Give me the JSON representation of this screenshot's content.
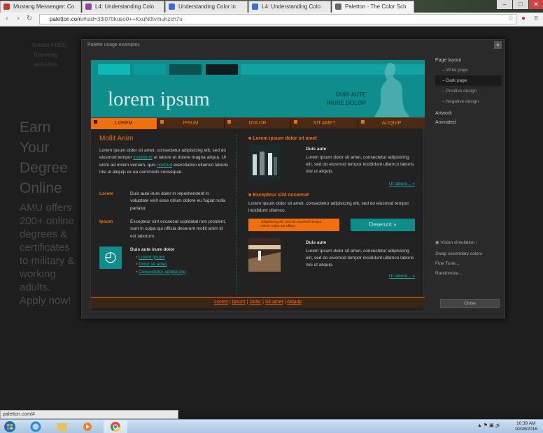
{
  "browser": {
    "tabs": [
      {
        "label": "Mustang Messenger: Co",
        "color": "#c0392b"
      },
      {
        "label": "L4: Understanding Colo",
        "color": "#8e44ad"
      },
      {
        "label": "Understanding Color in",
        "color": "#3a6fd8"
      },
      {
        "label": "L4: Understanding Colo",
        "color": "#3a6fd8"
      },
      {
        "label": "Paletton - The Color Sch",
        "color": "#666666"
      }
    ],
    "url_host": "paletton.com",
    "url_path": "/#uid=33i070kuso0++KxuN0tvmuhzch7u",
    "window_buttons": [
      "–",
      "□",
      "✕"
    ]
  },
  "background": {
    "ghost_links": [
      "Create FREE",
      "Stunning",
      "websites"
    ],
    "ad_big": "Earn Your Degree Online",
    "ad_small": "AMU offers 200+ online degrees & certificates to military & working adults. Apply now!"
  },
  "modal": {
    "title": "Palette usage examples",
    "close": "×",
    "header": {
      "title": "lorem ipsum",
      "tagline_1": "DUIS AUTE",
      "tagline_2": "IRURE DOLOR",
      "swatches": [
        "#0fb8b8",
        "#0a9a9a",
        "#0d5050",
        "#111d1d"
      ]
    },
    "menu": [
      "LOREM",
      "IPSUM",
      "DOLOR",
      "SIT AMET",
      "ALIQUIP"
    ],
    "left": {
      "heading": "Mollit Anim",
      "para1_a": "Lorem ipsum dolor sit amet, consectetur adipisicing elit, sed do eiusmod tempor ",
      "para1_link1": "incididunt",
      "para1_b": " ut labore et dolore magna aliqua. Ut enim ad minim veniam, quis ",
      "para1_link2": "nostrud",
      "para1_c": " exercitation ullamco laboris nisi ut aliquip ex ea commodo consequat.",
      "item1_label": "Lorem",
      "item1_text": "Duis aute irure dolor in reprehenderit in voluptate velit esse cillum dolore eu fugiat nulla pariatur.",
      "item2_label": "Ipsum",
      "item2_text": "Excepteur sint occaecat cupidatat non proident, sunt in culpa qui officia deserunt mollit anim id est laborum.",
      "list_heading": "Duis aute irure dolor",
      "list": [
        "Lorem ipsum",
        "Dolor sit amet",
        "Consectetur adipisicing"
      ]
    },
    "right": {
      "h1": "Lorem ipsum dolor sit amet",
      "card1_title": "Duis aute",
      "card1_text": "Lorem ipsum dolor sit amet, consectetur adipisicing elit, sed do eiusmod tempor incididunt ullamco laboris nisi ut aliquip.",
      "card1_link": "Ut labore... »",
      "h2": "Excepteur sint occaecat",
      "p2": "Lorem ipsum dolor sit amet, consectetur adipisicing elit, sed do eiusmod tempor incididunt ullamco.",
      "notice": "Adipisicing elit, sed do eiusmod tempor sint in culpa qui officia",
      "cta": "Deserunt »",
      "card2_title": "Duis aute",
      "card2_text": "Lorem ipsum dolor sit amet, consectetur adipisicing elit, sed do eiusmod tempor incididunt ullamco laboris nisi ut aliquip.",
      "card2_link": "Ut labore... »"
    },
    "footer": [
      "Lorem",
      "Ipsum",
      "Dolor",
      "Sit amet",
      "Aliquip"
    ],
    "sidebar": {
      "layout_heading": "Page layout",
      "options": [
        "Write page",
        "Dark page",
        "Positive design",
        "Negative design"
      ],
      "selected": "Dark page",
      "artwork": "Artwork",
      "animated": "Animated",
      "vision": "Vision simulation",
      "swap": "Swap secondary colors",
      "fine": "Fine Tune...",
      "randomize": "Randomize...",
      "close": "Close"
    }
  },
  "status_url": "paletton.com/#",
  "taskbar": {
    "time": "10:39 AM",
    "date": "10/28/2016"
  }
}
